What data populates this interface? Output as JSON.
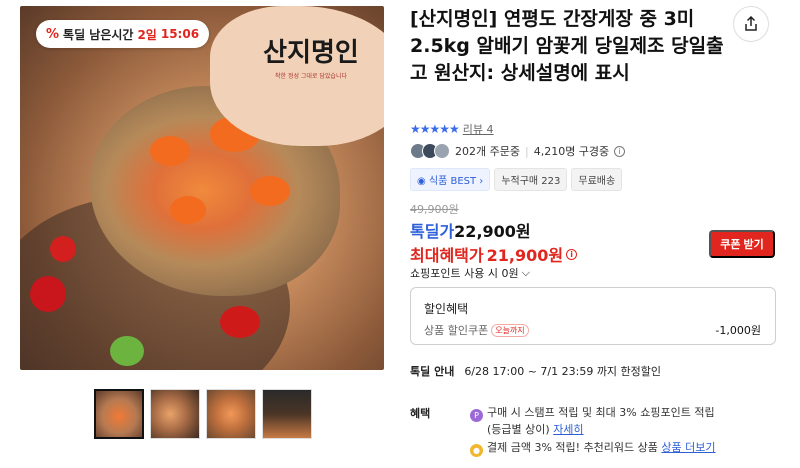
{
  "gallery": {
    "timer_badge": {
      "prefix_icon": "%",
      "label": "톡딜 남은시간",
      "days": "2일",
      "time": "15:06"
    },
    "brand_logo_text": "산지명인",
    "brand_logo_sub": "착한 정성 그대로 담았습니다",
    "thumbnails": [
      {
        "selected": true
      },
      {
        "selected": false
      },
      {
        "selected": false
      },
      {
        "selected": false
      }
    ]
  },
  "product": {
    "title": "[산지명인] 연평도 간장게장 중 3미 2.5kg 알배기 암꽃게 당일제조 당일출고 원산지: 상세설명에 표시",
    "rating": {
      "stars": "★★★★★",
      "review_label": "리뷰 4"
    },
    "buyers": {
      "orders": "202개 주문중",
      "subscribers": "4,210명 구경중"
    },
    "tags": [
      "식품 BEST",
      "누적구매 223",
      "무료배송"
    ],
    "price": {
      "original": "49,900원",
      "talkdeal_label": "톡딜가",
      "talkdeal_price": "22,900원",
      "max_benefit_label": "최대혜택가",
      "max_benefit_price": "21,900원",
      "coupon_button": "쿠폰 받기",
      "points_label": "쇼핑포인트 사용 시 0원"
    },
    "discount": {
      "header": "할인혜택",
      "coupon_label": "상품 할인쿠폰",
      "today_chip": "오늘까지",
      "amount": "-1,000원"
    },
    "deal_info": {
      "label": "톡딜 안내",
      "period": "6/28 17:00 ~ 7/1 23:59 까지 한정할인"
    },
    "perks": {
      "label": "혜택",
      "items": [
        {
          "icon": "point-icon",
          "line1": "구매 시 스탬프 적립 및 최대 3% 쇼핑포인트 적립",
          "line2": "(등급별 상이)",
          "link": "자세히"
        },
        {
          "icon": "coin-icon",
          "text": "결제 금액 3% 적립! 추천리워드 상품",
          "link": "상품 더보기"
        }
      ]
    }
  },
  "colors": {
    "accent_red": "#e0261e",
    "accent_blue": "#2d5fd8"
  }
}
